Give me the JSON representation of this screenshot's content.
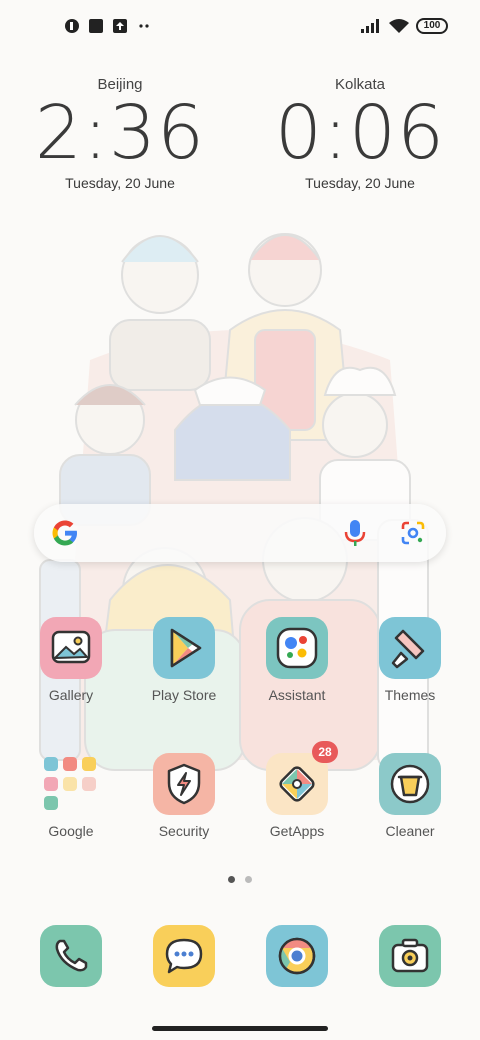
{
  "status_bar": {
    "left_icons": [
      "app-notification-icon",
      "stop-square-icon",
      "upload-icon",
      "more-dots-icon"
    ],
    "right_icons": [
      "signal-icon",
      "wifi-icon"
    ],
    "battery": "100"
  },
  "clocks": [
    {
      "city": "Beijing",
      "time": "2:36",
      "date": "Tuesday, 20 June"
    },
    {
      "city": "Kolkata",
      "time": "0:06",
      "date": "Tuesday, 20 June"
    }
  ],
  "search": {
    "icons": [
      "google-logo-icon",
      "microphone-icon",
      "google-lens-icon"
    ]
  },
  "apps_row1": [
    {
      "label": "Gallery",
      "icon": "gallery-icon",
      "color": "#f2a7b5"
    },
    {
      "label": "Play Store",
      "icon": "play-store-icon",
      "color": "#7ec5d6"
    },
    {
      "label": "Assistant",
      "icon": "assistant-icon",
      "color": "#7cc5c0"
    },
    {
      "label": "Themes",
      "icon": "themes-brush-icon",
      "color": "#7ec5d6"
    }
  ],
  "apps_row2": [
    {
      "label": "Google",
      "icon": "google-folder-icon"
    },
    {
      "label": "Security",
      "icon": "security-shield-icon",
      "color": "#f5b5a5"
    },
    {
      "label": "GetApps",
      "icon": "getapps-icon",
      "color": "#fbe5c5",
      "badge": "28"
    },
    {
      "label": "Cleaner",
      "icon": "cleaner-bin-icon",
      "color": "#8cc9c9"
    }
  ],
  "dock": [
    {
      "icon": "phone-icon",
      "color": "#7cc6ad"
    },
    {
      "icon": "messages-icon",
      "color": "#f9cf5a"
    },
    {
      "icon": "chrome-icon",
      "color": "#7ec5d6"
    },
    {
      "icon": "camera-icon",
      "color": "#7cc6ad"
    }
  ],
  "page_indicator": {
    "pages": 2,
    "current": 1
  }
}
